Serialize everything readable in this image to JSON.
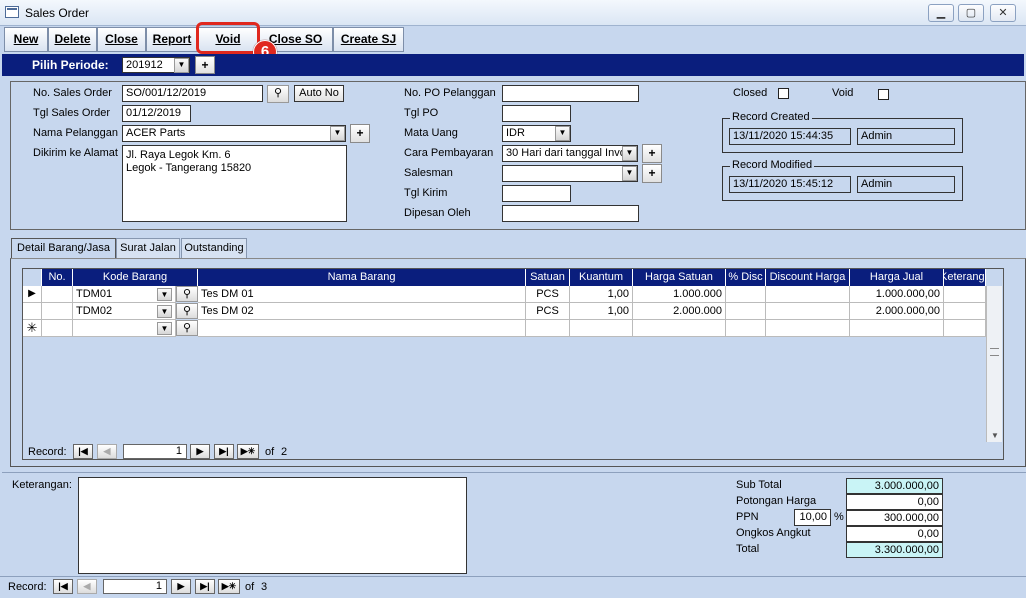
{
  "window": {
    "title": "Sales Order",
    "min": "▁",
    "max": "▢",
    "close": "✕"
  },
  "toolbar": [
    "New",
    "Delete",
    "Close",
    "Report",
    "Void",
    "Close SO",
    "Create SJ"
  ],
  "callout": {
    "number": "6"
  },
  "periode": {
    "label": "Pilih Periode:",
    "value": "201912",
    "plus": "+"
  },
  "header": {
    "no_sales_order_label": "No. Sales Order",
    "no_sales_order": "SO/001/12/2019",
    "auto_no": "Auto No",
    "tgl_label": "Tgl Sales Order",
    "tgl": "01/12/2019",
    "pelanggan_label": "Nama Pelanggan",
    "pelanggan": "ACER Parts",
    "alamat_label": "Dikirim ke Alamat",
    "alamat_line1": "Jl. Raya Legok Km. 6",
    "alamat_line2": "Legok - Tangerang 15820",
    "po_label": "No. PO Pelanggan",
    "po": "",
    "tgl_po_label": "Tgl PO",
    "tgl_po": "",
    "mata_uang_label": "Mata Uang",
    "mata_uang": "IDR",
    "cara_bayar_label": "Cara Pembayaran",
    "cara_bayar": "30 Hari dari tanggal Invo",
    "salesman_label": "Salesman",
    "salesman": "",
    "tgl_kirim_label": "Tgl Kirim",
    "tgl_kirim": "",
    "dipesan_label": "Dipesan Oleh",
    "dipesan": "",
    "closed_label": "Closed",
    "void_label": "Void",
    "record_created_label": "Record Created",
    "record_created_date": "13/11/2020 15:44:35",
    "record_created_user": "Admin",
    "record_modified_label": "Record Modified",
    "record_modified_date": "13/11/2020 15:45:12",
    "record_modified_user": "Admin"
  },
  "tabs": [
    "Detail Barang/Jasa",
    "Surat Jalan",
    "Outstanding"
  ],
  "grid": {
    "columns": [
      "No.",
      "Kode Barang",
      "Nama Barang",
      "Satuan",
      "Kuantum",
      "Harga Satuan",
      "% Disc",
      "Discount Harga",
      "Harga Jual",
      "Keterangan"
    ],
    "rows": [
      {
        "no": "",
        "kode": "TDM01",
        "nama": "Tes DM 01",
        "satuan": "PCS",
        "kuantum": "1,00",
        "harga_satuan": "1.000.000",
        "disc": "",
        "discount_harga": "",
        "harga_jual": "1.000.000,00",
        "keterangan": ""
      },
      {
        "no": "",
        "kode": "TDM02",
        "nama": "Tes DM 02",
        "satuan": "PCS",
        "kuantum": "1,00",
        "harga_satuan": "2.000.000",
        "disc": "",
        "discount_harga": "",
        "harga_jual": "2.000.000,00",
        "keterangan": ""
      }
    ],
    "record_label": "Record:",
    "record_current": "1",
    "record_of": "of",
    "record_total": "2"
  },
  "footer": {
    "keterangan_label": "Keterangan:",
    "keterangan": "",
    "subtotal_label": "Sub Total",
    "subtotal": "3.000.000,00",
    "potongan_label": "Potongan Harga",
    "potongan": "0,00",
    "ppn_label": "PPN",
    "ppn_rate": "10,00",
    "ppn_pct": "%",
    "ppn": "300.000,00",
    "ongkos_label": "Ongkos Angkut",
    "ongkos": "0,00",
    "total_label": "Total",
    "total": "3.300.000,00",
    "record_label": "Record:",
    "record_current": "1",
    "record_of": "of",
    "record_total": "3"
  },
  "colors": {
    "header_navy": "#0a1e7d",
    "form_bg": "#c7d7ee",
    "callout_red": "#e0281e",
    "total_cyan": "#c9f4f6"
  },
  "icons": [
    "form-icon",
    "search-icon",
    "dropdown-arrow-icon",
    "first-record-icon",
    "prev-record-icon",
    "next-record-icon",
    "last-record-icon",
    "new-record-icon",
    "current-row-icon",
    "new-row-icon"
  ]
}
